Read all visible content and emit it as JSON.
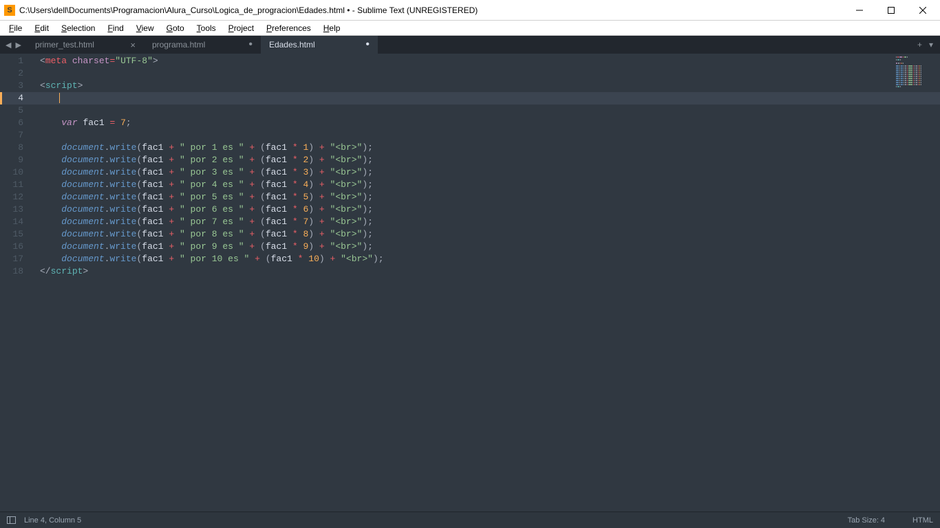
{
  "window": {
    "title": "C:\\Users\\dell\\Documents\\Programacion\\Alura_Curso\\Logica_de_progracion\\Edades.html • - Sublime Text (UNREGISTERED)"
  },
  "menu": {
    "items": [
      "File",
      "Edit",
      "Selection",
      "Find",
      "View",
      "Goto",
      "Tools",
      "Project",
      "Preferences",
      "Help"
    ]
  },
  "tabs": {
    "items": [
      {
        "label": "primer_test.html",
        "dirty": false,
        "active": false
      },
      {
        "label": "programa.html",
        "dirty": true,
        "active": false
      },
      {
        "label": "Edades.html",
        "dirty": true,
        "active": true
      }
    ],
    "add_label": "+",
    "dropdown_label": "▾"
  },
  "editor": {
    "active_line": 4,
    "line_count": 18
  },
  "status": {
    "position": "Line 4, Column 5",
    "tab_size": "Tab Size: 4",
    "syntax": "HTML"
  },
  "code_lines": [
    [
      {
        "c": "c-punct",
        "t": "<"
      },
      {
        "c": "c-tag",
        "t": "meta"
      },
      {
        "c": "",
        "t": " "
      },
      {
        "c": "c-attr",
        "t": "charset"
      },
      {
        "c": "c-op",
        "t": "="
      },
      {
        "c": "c-string",
        "t": "\"UTF-8\""
      },
      {
        "c": "c-punct",
        "t": ">"
      }
    ],
    [],
    [
      {
        "c": "c-punct",
        "t": "<"
      },
      {
        "c": "c-scr",
        "t": "script"
      },
      {
        "c": "c-punct",
        "t": ">"
      }
    ],
    [
      {
        "c": "",
        "t": "    "
      }
    ],
    [],
    [
      {
        "c": "",
        "t": "    "
      },
      {
        "c": "c-keyword",
        "t": "var"
      },
      {
        "c": "",
        "t": " "
      },
      {
        "c": "c-var",
        "t": "fac1"
      },
      {
        "c": "",
        "t": " "
      },
      {
        "c": "c-op",
        "t": "="
      },
      {
        "c": "",
        "t": " "
      },
      {
        "c": "c-num",
        "t": "7"
      },
      {
        "c": "c-punct",
        "t": ";"
      }
    ],
    [],
    [
      {
        "c": "",
        "t": "    "
      },
      {
        "c": "c-obj",
        "t": "document"
      },
      {
        "c": "c-punct",
        "t": "."
      },
      {
        "c": "c-func",
        "t": "write"
      },
      {
        "c": "c-punct",
        "t": "("
      },
      {
        "c": "c-var",
        "t": "fac1"
      },
      {
        "c": "",
        "t": " "
      },
      {
        "c": "c-op",
        "t": "+"
      },
      {
        "c": "",
        "t": " "
      },
      {
        "c": "c-string",
        "t": "\" por 1 es \""
      },
      {
        "c": "",
        "t": " "
      },
      {
        "c": "c-op",
        "t": "+"
      },
      {
        "c": "",
        "t": " "
      },
      {
        "c": "c-punct",
        "t": "("
      },
      {
        "c": "c-var",
        "t": "fac1"
      },
      {
        "c": "",
        "t": " "
      },
      {
        "c": "c-op",
        "t": "*"
      },
      {
        "c": "",
        "t": " "
      },
      {
        "c": "c-num",
        "t": "1"
      },
      {
        "c": "c-punct",
        "t": ")"
      },
      {
        "c": "",
        "t": " "
      },
      {
        "c": "c-op",
        "t": "+"
      },
      {
        "c": "",
        "t": " "
      },
      {
        "c": "c-string",
        "t": "\"<br>\""
      },
      {
        "c": "c-punct",
        "t": ");"
      }
    ],
    [
      {
        "c": "",
        "t": "    "
      },
      {
        "c": "c-obj",
        "t": "document"
      },
      {
        "c": "c-punct",
        "t": "."
      },
      {
        "c": "c-func",
        "t": "write"
      },
      {
        "c": "c-punct",
        "t": "("
      },
      {
        "c": "c-var",
        "t": "fac1"
      },
      {
        "c": "",
        "t": " "
      },
      {
        "c": "c-op",
        "t": "+"
      },
      {
        "c": "",
        "t": " "
      },
      {
        "c": "c-string",
        "t": "\" por 2 es \""
      },
      {
        "c": "",
        "t": " "
      },
      {
        "c": "c-op",
        "t": "+"
      },
      {
        "c": "",
        "t": " "
      },
      {
        "c": "c-punct",
        "t": "("
      },
      {
        "c": "c-var",
        "t": "fac1"
      },
      {
        "c": "",
        "t": " "
      },
      {
        "c": "c-op",
        "t": "*"
      },
      {
        "c": "",
        "t": " "
      },
      {
        "c": "c-num",
        "t": "2"
      },
      {
        "c": "c-punct",
        "t": ")"
      },
      {
        "c": "",
        "t": " "
      },
      {
        "c": "c-op",
        "t": "+"
      },
      {
        "c": "",
        "t": " "
      },
      {
        "c": "c-string",
        "t": "\"<br>\""
      },
      {
        "c": "c-punct",
        "t": ");"
      }
    ],
    [
      {
        "c": "",
        "t": "    "
      },
      {
        "c": "c-obj",
        "t": "document"
      },
      {
        "c": "c-punct",
        "t": "."
      },
      {
        "c": "c-func",
        "t": "write"
      },
      {
        "c": "c-punct",
        "t": "("
      },
      {
        "c": "c-var",
        "t": "fac1"
      },
      {
        "c": "",
        "t": " "
      },
      {
        "c": "c-op",
        "t": "+"
      },
      {
        "c": "",
        "t": " "
      },
      {
        "c": "c-string",
        "t": "\" por 3 es \""
      },
      {
        "c": "",
        "t": " "
      },
      {
        "c": "c-op",
        "t": "+"
      },
      {
        "c": "",
        "t": " "
      },
      {
        "c": "c-punct",
        "t": "("
      },
      {
        "c": "c-var",
        "t": "fac1"
      },
      {
        "c": "",
        "t": " "
      },
      {
        "c": "c-op",
        "t": "*"
      },
      {
        "c": "",
        "t": " "
      },
      {
        "c": "c-num",
        "t": "3"
      },
      {
        "c": "c-punct",
        "t": ")"
      },
      {
        "c": "",
        "t": " "
      },
      {
        "c": "c-op",
        "t": "+"
      },
      {
        "c": "",
        "t": " "
      },
      {
        "c": "c-string",
        "t": "\"<br>\""
      },
      {
        "c": "c-punct",
        "t": ");"
      }
    ],
    [
      {
        "c": "",
        "t": "    "
      },
      {
        "c": "c-obj",
        "t": "document"
      },
      {
        "c": "c-punct",
        "t": "."
      },
      {
        "c": "c-func",
        "t": "write"
      },
      {
        "c": "c-punct",
        "t": "("
      },
      {
        "c": "c-var",
        "t": "fac1"
      },
      {
        "c": "",
        "t": " "
      },
      {
        "c": "c-op",
        "t": "+"
      },
      {
        "c": "",
        "t": " "
      },
      {
        "c": "c-string",
        "t": "\" por 4 es \""
      },
      {
        "c": "",
        "t": " "
      },
      {
        "c": "c-op",
        "t": "+"
      },
      {
        "c": "",
        "t": " "
      },
      {
        "c": "c-punct",
        "t": "("
      },
      {
        "c": "c-var",
        "t": "fac1"
      },
      {
        "c": "",
        "t": " "
      },
      {
        "c": "c-op",
        "t": "*"
      },
      {
        "c": "",
        "t": " "
      },
      {
        "c": "c-num",
        "t": "4"
      },
      {
        "c": "c-punct",
        "t": ")"
      },
      {
        "c": "",
        "t": " "
      },
      {
        "c": "c-op",
        "t": "+"
      },
      {
        "c": "",
        "t": " "
      },
      {
        "c": "c-string",
        "t": "\"<br>\""
      },
      {
        "c": "c-punct",
        "t": ");"
      }
    ],
    [
      {
        "c": "",
        "t": "    "
      },
      {
        "c": "c-obj",
        "t": "document"
      },
      {
        "c": "c-punct",
        "t": "."
      },
      {
        "c": "c-func",
        "t": "write"
      },
      {
        "c": "c-punct",
        "t": "("
      },
      {
        "c": "c-var",
        "t": "fac1"
      },
      {
        "c": "",
        "t": " "
      },
      {
        "c": "c-op",
        "t": "+"
      },
      {
        "c": "",
        "t": " "
      },
      {
        "c": "c-string",
        "t": "\" por 5 es \""
      },
      {
        "c": "",
        "t": " "
      },
      {
        "c": "c-op",
        "t": "+"
      },
      {
        "c": "",
        "t": " "
      },
      {
        "c": "c-punct",
        "t": "("
      },
      {
        "c": "c-var",
        "t": "fac1"
      },
      {
        "c": "",
        "t": " "
      },
      {
        "c": "c-op",
        "t": "*"
      },
      {
        "c": "",
        "t": " "
      },
      {
        "c": "c-num",
        "t": "5"
      },
      {
        "c": "c-punct",
        "t": ")"
      },
      {
        "c": "",
        "t": " "
      },
      {
        "c": "c-op",
        "t": "+"
      },
      {
        "c": "",
        "t": " "
      },
      {
        "c": "c-string",
        "t": "\"<br>\""
      },
      {
        "c": "c-punct",
        "t": ");"
      }
    ],
    [
      {
        "c": "",
        "t": "    "
      },
      {
        "c": "c-obj",
        "t": "document"
      },
      {
        "c": "c-punct",
        "t": "."
      },
      {
        "c": "c-func",
        "t": "write"
      },
      {
        "c": "c-punct",
        "t": "("
      },
      {
        "c": "c-var",
        "t": "fac1"
      },
      {
        "c": "",
        "t": " "
      },
      {
        "c": "c-op",
        "t": "+"
      },
      {
        "c": "",
        "t": " "
      },
      {
        "c": "c-string",
        "t": "\" por 6 es \""
      },
      {
        "c": "",
        "t": " "
      },
      {
        "c": "c-op",
        "t": "+"
      },
      {
        "c": "",
        "t": " "
      },
      {
        "c": "c-punct",
        "t": "("
      },
      {
        "c": "c-var",
        "t": "fac1"
      },
      {
        "c": "",
        "t": " "
      },
      {
        "c": "c-op",
        "t": "*"
      },
      {
        "c": "",
        "t": " "
      },
      {
        "c": "c-num",
        "t": "6"
      },
      {
        "c": "c-punct",
        "t": ")"
      },
      {
        "c": "",
        "t": " "
      },
      {
        "c": "c-op",
        "t": "+"
      },
      {
        "c": "",
        "t": " "
      },
      {
        "c": "c-string",
        "t": "\"<br>\""
      },
      {
        "c": "c-punct",
        "t": ");"
      }
    ],
    [
      {
        "c": "",
        "t": "    "
      },
      {
        "c": "c-obj",
        "t": "document"
      },
      {
        "c": "c-punct",
        "t": "."
      },
      {
        "c": "c-func",
        "t": "write"
      },
      {
        "c": "c-punct",
        "t": "("
      },
      {
        "c": "c-var",
        "t": "fac1"
      },
      {
        "c": "",
        "t": " "
      },
      {
        "c": "c-op",
        "t": "+"
      },
      {
        "c": "",
        "t": " "
      },
      {
        "c": "c-string",
        "t": "\" por 7 es \""
      },
      {
        "c": "",
        "t": " "
      },
      {
        "c": "c-op",
        "t": "+"
      },
      {
        "c": "",
        "t": " "
      },
      {
        "c": "c-punct",
        "t": "("
      },
      {
        "c": "c-var",
        "t": "fac1"
      },
      {
        "c": "",
        "t": " "
      },
      {
        "c": "c-op",
        "t": "*"
      },
      {
        "c": "",
        "t": " "
      },
      {
        "c": "c-num",
        "t": "7"
      },
      {
        "c": "c-punct",
        "t": ")"
      },
      {
        "c": "",
        "t": " "
      },
      {
        "c": "c-op",
        "t": "+"
      },
      {
        "c": "",
        "t": " "
      },
      {
        "c": "c-string",
        "t": "\"<br>\""
      },
      {
        "c": "c-punct",
        "t": ");"
      }
    ],
    [
      {
        "c": "",
        "t": "    "
      },
      {
        "c": "c-obj",
        "t": "document"
      },
      {
        "c": "c-punct",
        "t": "."
      },
      {
        "c": "c-func",
        "t": "write"
      },
      {
        "c": "c-punct",
        "t": "("
      },
      {
        "c": "c-var",
        "t": "fac1"
      },
      {
        "c": "",
        "t": " "
      },
      {
        "c": "c-op",
        "t": "+"
      },
      {
        "c": "",
        "t": " "
      },
      {
        "c": "c-string",
        "t": "\" por 8 es \""
      },
      {
        "c": "",
        "t": " "
      },
      {
        "c": "c-op",
        "t": "+"
      },
      {
        "c": "",
        "t": " "
      },
      {
        "c": "c-punct",
        "t": "("
      },
      {
        "c": "c-var",
        "t": "fac1"
      },
      {
        "c": "",
        "t": " "
      },
      {
        "c": "c-op",
        "t": "*"
      },
      {
        "c": "",
        "t": " "
      },
      {
        "c": "c-num",
        "t": "8"
      },
      {
        "c": "c-punct",
        "t": ")"
      },
      {
        "c": "",
        "t": " "
      },
      {
        "c": "c-op",
        "t": "+"
      },
      {
        "c": "",
        "t": " "
      },
      {
        "c": "c-string",
        "t": "\"<br>\""
      },
      {
        "c": "c-punct",
        "t": ");"
      }
    ],
    [
      {
        "c": "",
        "t": "    "
      },
      {
        "c": "c-obj",
        "t": "document"
      },
      {
        "c": "c-punct",
        "t": "."
      },
      {
        "c": "c-func",
        "t": "write"
      },
      {
        "c": "c-punct",
        "t": "("
      },
      {
        "c": "c-var",
        "t": "fac1"
      },
      {
        "c": "",
        "t": " "
      },
      {
        "c": "c-op",
        "t": "+"
      },
      {
        "c": "",
        "t": " "
      },
      {
        "c": "c-string",
        "t": "\" por 9 es \""
      },
      {
        "c": "",
        "t": " "
      },
      {
        "c": "c-op",
        "t": "+"
      },
      {
        "c": "",
        "t": " "
      },
      {
        "c": "c-punct",
        "t": "("
      },
      {
        "c": "c-var",
        "t": "fac1"
      },
      {
        "c": "",
        "t": " "
      },
      {
        "c": "c-op",
        "t": "*"
      },
      {
        "c": "",
        "t": " "
      },
      {
        "c": "c-num",
        "t": "9"
      },
      {
        "c": "c-punct",
        "t": ")"
      },
      {
        "c": "",
        "t": " "
      },
      {
        "c": "c-op",
        "t": "+"
      },
      {
        "c": "",
        "t": " "
      },
      {
        "c": "c-string",
        "t": "\"<br>\""
      },
      {
        "c": "c-punct",
        "t": ");"
      }
    ],
    [
      {
        "c": "",
        "t": "    "
      },
      {
        "c": "c-obj",
        "t": "document"
      },
      {
        "c": "c-punct",
        "t": "."
      },
      {
        "c": "c-func",
        "t": "write"
      },
      {
        "c": "c-punct",
        "t": "("
      },
      {
        "c": "c-var",
        "t": "fac1"
      },
      {
        "c": "",
        "t": " "
      },
      {
        "c": "c-op",
        "t": "+"
      },
      {
        "c": "",
        "t": " "
      },
      {
        "c": "c-string",
        "t": "\" por 10 es \""
      },
      {
        "c": "",
        "t": " "
      },
      {
        "c": "c-op",
        "t": "+"
      },
      {
        "c": "",
        "t": " "
      },
      {
        "c": "c-punct",
        "t": "("
      },
      {
        "c": "c-var",
        "t": "fac1"
      },
      {
        "c": "",
        "t": " "
      },
      {
        "c": "c-op",
        "t": "*"
      },
      {
        "c": "",
        "t": " "
      },
      {
        "c": "c-num",
        "t": "10"
      },
      {
        "c": "c-punct",
        "t": ")"
      },
      {
        "c": "",
        "t": " "
      },
      {
        "c": "c-op",
        "t": "+"
      },
      {
        "c": "",
        "t": " "
      },
      {
        "c": "c-string",
        "t": "\"<br>\""
      },
      {
        "c": "c-punct",
        "t": ");"
      }
    ],
    [
      {
        "c": "c-punct",
        "t": "</"
      },
      {
        "c": "c-scr",
        "t": "script"
      },
      {
        "c": "c-punct",
        "t": ">"
      }
    ]
  ]
}
